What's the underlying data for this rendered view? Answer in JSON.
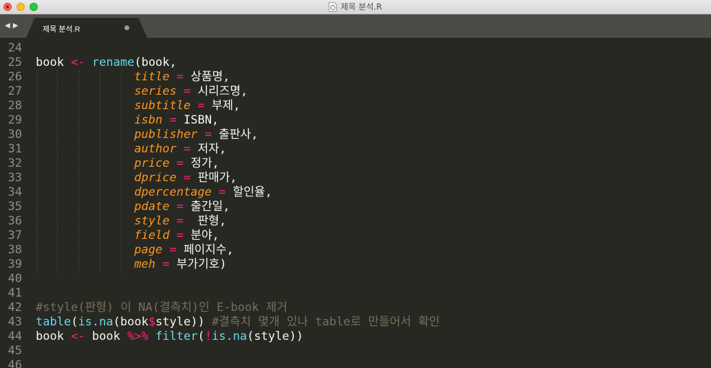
{
  "window": {
    "title": "제목 분석.R"
  },
  "tab": {
    "label": "제목 분석.R",
    "modified": true
  },
  "colors": {
    "background": "#272822",
    "keyword": "#f92672",
    "function": "#66d9ef",
    "argument": "#fd971f",
    "comment": "#75715e",
    "text": "#f8f8f2"
  },
  "lines": [
    {
      "n": "24",
      "tokens": []
    },
    {
      "n": "25",
      "tokens": [
        [
          "t",
          "book "
        ],
        [
          "kw",
          "<-"
        ],
        [
          "t",
          " "
        ],
        [
          "fn",
          "rename"
        ],
        [
          "t",
          "(book,"
        ]
      ]
    },
    {
      "n": "26",
      "guides": true,
      "tokens": [
        [
          "sp",
          "              "
        ],
        [
          "arg",
          "title"
        ],
        [
          "t",
          " "
        ],
        [
          "kw",
          "="
        ],
        [
          "t",
          " 상품명,"
        ]
      ]
    },
    {
      "n": "27",
      "guides": true,
      "tokens": [
        [
          "sp",
          "              "
        ],
        [
          "arg",
          "series"
        ],
        [
          "t",
          " "
        ],
        [
          "kw",
          "="
        ],
        [
          "t",
          " 시리즈명,"
        ]
      ]
    },
    {
      "n": "28",
      "guides": true,
      "tokens": [
        [
          "sp",
          "              "
        ],
        [
          "arg",
          "subtitle"
        ],
        [
          "t",
          " "
        ],
        [
          "kw",
          "="
        ],
        [
          "t",
          " 부제,"
        ]
      ]
    },
    {
      "n": "29",
      "guides": true,
      "tokens": [
        [
          "sp",
          "              "
        ],
        [
          "arg",
          "isbn"
        ],
        [
          "t",
          " "
        ],
        [
          "kw",
          "="
        ],
        [
          "t",
          " ISBN,"
        ]
      ]
    },
    {
      "n": "30",
      "guides": true,
      "tokens": [
        [
          "sp",
          "              "
        ],
        [
          "arg",
          "publisher"
        ],
        [
          "t",
          " "
        ],
        [
          "kw",
          "="
        ],
        [
          "t",
          " 출판사,"
        ]
      ]
    },
    {
      "n": "31",
      "guides": true,
      "tokens": [
        [
          "sp",
          "              "
        ],
        [
          "arg",
          "author"
        ],
        [
          "t",
          " "
        ],
        [
          "kw",
          "="
        ],
        [
          "t",
          " 저자,"
        ]
      ]
    },
    {
      "n": "32",
      "guides": true,
      "tokens": [
        [
          "sp",
          "              "
        ],
        [
          "arg",
          "price"
        ],
        [
          "t",
          " "
        ],
        [
          "kw",
          "="
        ],
        [
          "t",
          " 정가,"
        ]
      ]
    },
    {
      "n": "33",
      "guides": true,
      "tokens": [
        [
          "sp",
          "              "
        ],
        [
          "arg",
          "dprice"
        ],
        [
          "t",
          " "
        ],
        [
          "kw",
          "="
        ],
        [
          "t",
          " 판매가,"
        ]
      ]
    },
    {
      "n": "34",
      "guides": true,
      "tokens": [
        [
          "sp",
          "              "
        ],
        [
          "arg",
          "dpercentage"
        ],
        [
          "t",
          " "
        ],
        [
          "kw",
          "="
        ],
        [
          "t",
          " 할인율,"
        ]
      ]
    },
    {
      "n": "35",
      "guides": true,
      "tokens": [
        [
          "sp",
          "              "
        ],
        [
          "arg",
          "pdate"
        ],
        [
          "t",
          " "
        ],
        [
          "kw",
          "="
        ],
        [
          "t",
          " 출간일,"
        ]
      ]
    },
    {
      "n": "36",
      "guides": true,
      "tokens": [
        [
          "sp",
          "              "
        ],
        [
          "arg",
          "style"
        ],
        [
          "t",
          " "
        ],
        [
          "kw",
          "="
        ],
        [
          "t",
          "  판형,"
        ]
      ]
    },
    {
      "n": "37",
      "guides": true,
      "tokens": [
        [
          "sp",
          "              "
        ],
        [
          "arg",
          "field"
        ],
        [
          "t",
          " "
        ],
        [
          "kw",
          "="
        ],
        [
          "t",
          " 분야,"
        ]
      ]
    },
    {
      "n": "38",
      "guides": true,
      "tokens": [
        [
          "sp",
          "              "
        ],
        [
          "arg",
          "page"
        ],
        [
          "t",
          " "
        ],
        [
          "kw",
          "="
        ],
        [
          "t",
          " 페이지수,"
        ]
      ]
    },
    {
      "n": "39",
      "guides": true,
      "tokens": [
        [
          "sp",
          "              "
        ],
        [
          "arg",
          "meh"
        ],
        [
          "t",
          " "
        ],
        [
          "kw",
          "="
        ],
        [
          "t",
          " 부가기호)"
        ]
      ]
    },
    {
      "n": "40",
      "tokens": []
    },
    {
      "n": "41",
      "tokens": []
    },
    {
      "n": "42",
      "tokens": [
        [
          "cm",
          "#style(판형) 이 NA(결측치)인 E-book 제거"
        ]
      ]
    },
    {
      "n": "43",
      "tokens": [
        [
          "fn",
          "table"
        ],
        [
          "t",
          "("
        ],
        [
          "fn",
          "is.na"
        ],
        [
          "t",
          "(book"
        ],
        [
          "kw",
          "$"
        ],
        [
          "t",
          "style)) "
        ],
        [
          "cm",
          "#결측치 몇개 있나 table로 만들어서 확인"
        ]
      ]
    },
    {
      "n": "44",
      "tokens": [
        [
          "t",
          "book "
        ],
        [
          "kw",
          "<-"
        ],
        [
          "t",
          " book "
        ],
        [
          "kw",
          "%>%"
        ],
        [
          "t",
          " "
        ],
        [
          "fn",
          "filter"
        ],
        [
          "t",
          "("
        ],
        [
          "kw",
          "!"
        ],
        [
          "fn",
          "is.na"
        ],
        [
          "t",
          "(style))"
        ]
      ]
    },
    {
      "n": "45",
      "tokens": []
    },
    {
      "n": "46",
      "tokens": []
    }
  ]
}
